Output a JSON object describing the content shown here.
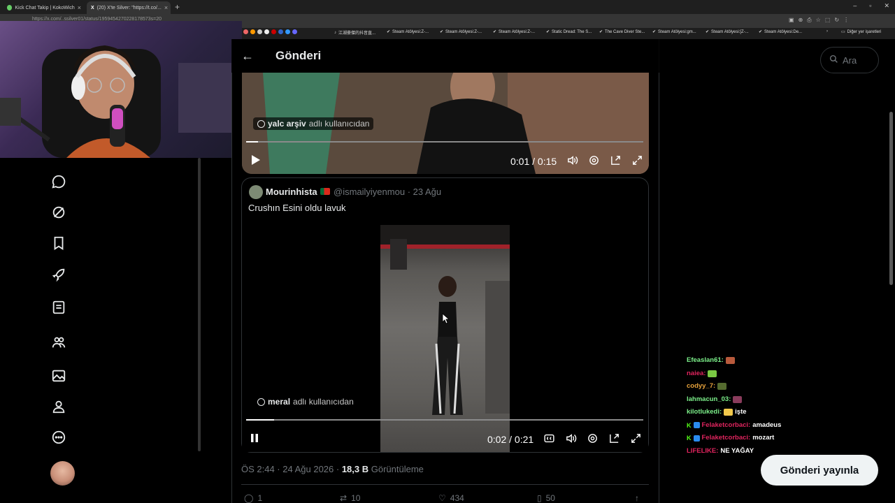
{
  "browser": {
    "tabs": [
      {
        "label": "Kick Chat Takip | KokoWich"
      },
      {
        "label": "(20) X'te Silver: \"https://t.co/..."
      }
    ],
    "url": "https://x.com/..ssilver01/status/1959454270228178573s=20",
    "bookmarks": [
      "江湖豪傑的抖音直...",
      "Steam Atölyesi:Z-...",
      "Steam Atölyesi:Z-...",
      "Steam Atölyesi:Z-...",
      "Static Dread: The S...",
      "The Cave Diver Ste...",
      "Steam Atölyesi:gm...",
      "Steam Atölyesi:[Z-...",
      "Steam Atölyesi:De..."
    ],
    "other_bookmarks": "Diğer yer işaretleri"
  },
  "left_nav": {
    "icons": [
      "chat-icon",
      "grok-icon",
      "bookmark-icon",
      "rocket-icon",
      "lists-icon",
      "communities-icon",
      "media-icon",
      "profile-icon",
      "more-icon"
    ]
  },
  "header": {
    "title": "Gönderi"
  },
  "video1": {
    "attribution_user": "yalc arşiv",
    "attribution_suffix": "adlı kullanıcıdan",
    "time": "0:01 / 0:15",
    "progress": 0.03
  },
  "quote": {
    "name": "Mourinhista",
    "handle": "@ismailyiyenmou",
    "date": "· 23 Ağu",
    "text": "Crushın Esini oldu lavuk",
    "video": {
      "attribution_user": "meral",
      "attribution_suffix": "adlı kullanıcıdan",
      "time": "0:02 / 0:21",
      "progress": 0.07
    }
  },
  "meta": {
    "timestamp": "ÖS 2:44 · 24 Ağu 2026 · ",
    "views": "18,3 B",
    "views_label": " Görüntüleme"
  },
  "actions": {
    "replies": "1",
    "reposts": "10",
    "likes": "434",
    "bookmarks": "50"
  },
  "search": {
    "placeholder": "Ara"
  },
  "chat": [
    {
      "user": "Efeaslan61:",
      "color": "#7cf08a",
      "message": "",
      "emote": "#b85a3c"
    },
    {
      "user": "naiea:",
      "color": "#e0245e",
      "message": "",
      "emote": "#7ac943"
    },
    {
      "user": "codyy_7:",
      "color": "#e8a33c",
      "message": "",
      "emote": "#556b2f"
    },
    {
      "user": "lahmacun_03:",
      "color": "#7cf08a",
      "message": "",
      "emote": "#8a3c5c"
    },
    {
      "user": "kilotlukedi:",
      "color": "#7cf08a",
      "message": "işte",
      "emote": "#f2c94c"
    },
    {
      "user": "Felaketcorbaci:",
      "color": "#e0245e",
      "message": "amadeus",
      "badge": true
    },
    {
      "user": "Felaketcorbaci:",
      "color": "#e0245e",
      "message": "mozart",
      "badge": true
    },
    {
      "user": "LIFELIKE:",
      "color": "#e0245e",
      "message": "NE YAĞAY"
    }
  ],
  "publish_button": "Gönderi yayınla"
}
